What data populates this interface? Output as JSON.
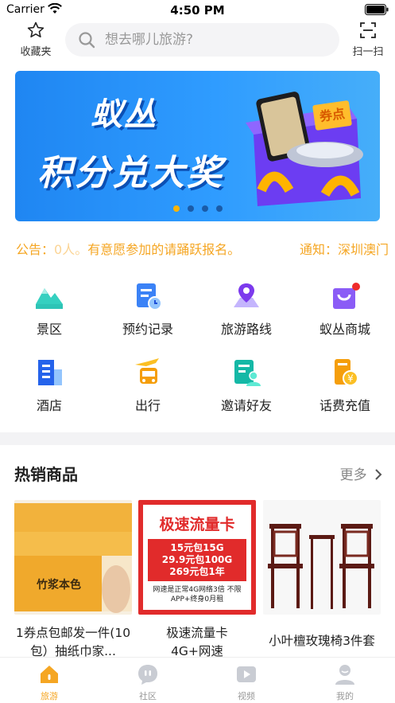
{
  "status_bar": {
    "carrier": "Carrier",
    "time": "4:50 PM"
  },
  "topnav": {
    "favorites_label": "收藏夹",
    "search_placeholder": "想去哪儿旅游?",
    "scan_label": "扫一扫"
  },
  "banner": {
    "line1": "蚁丛",
    "line2": "积分兑大奖",
    "badge": "券点",
    "dots": 4,
    "active_dot": 0
  },
  "notice": {
    "prefix": "公告：",
    "faded": "0人。",
    "text": "有意愿参加的请踊跃报名。",
    "second": "通知：深圳澳门"
  },
  "quick_menu": [
    {
      "label": "景区",
      "icon": "mountain-icon"
    },
    {
      "label": "预约记录",
      "icon": "booking-record-icon"
    },
    {
      "label": "旅游路线",
      "icon": "route-icon"
    },
    {
      "label": "蚁丛商城",
      "icon": "shopping-bag-icon"
    },
    {
      "label": "酒店",
      "icon": "hotel-icon"
    },
    {
      "label": "出行",
      "icon": "travel-icon"
    },
    {
      "label": "邀请好友",
      "icon": "invite-friend-icon"
    },
    {
      "label": "话费充值",
      "icon": "phone-recharge-icon"
    }
  ],
  "hot_section": {
    "title": "热销商品",
    "more": "更多"
  },
  "products": [
    {
      "name": "1券点包邮发一件(10包）抽纸巾家...",
      "img_text": "竹浆本色"
    },
    {
      "name": "极速流量卡4G+网速",
      "card_title": "极速流量卡",
      "plans": [
        "15元包15G",
        "29.9元包100G",
        "269元包1年"
      ],
      "note": "网速是正常4G网络3倍 不限APP+终身0月租"
    },
    {
      "name": "小叶檀玫瑰椅3件套"
    }
  ],
  "tabbar": [
    {
      "label": "旅游",
      "icon": "home-travel-icon",
      "active": true
    },
    {
      "label": "社区",
      "icon": "community-icon",
      "active": false
    },
    {
      "label": "视频",
      "icon": "video-icon",
      "active": false
    },
    {
      "label": "我的",
      "icon": "profile-icon",
      "active": false
    }
  ],
  "colors": {
    "accent": "#f5a623",
    "banner_blue": "#2f9cff"
  }
}
